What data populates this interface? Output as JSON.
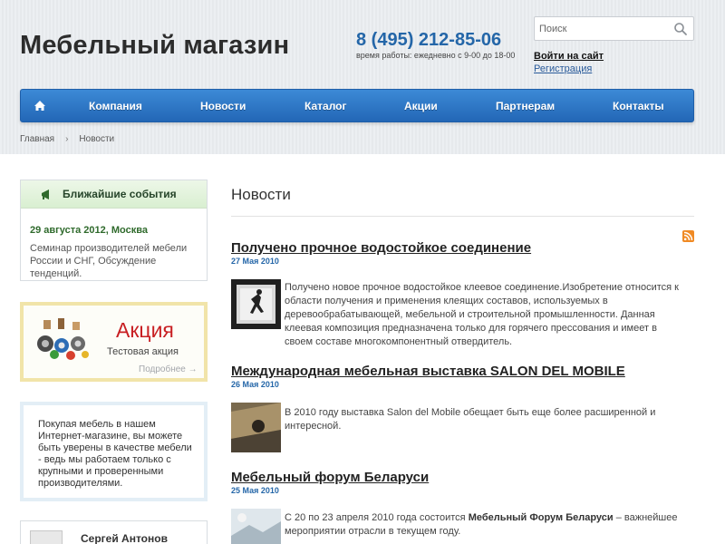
{
  "header": {
    "site_title": "Мебельный магазин",
    "phone": "8 (495) 212-85-06",
    "hours": "время работы: ежедневно с 9-00 до 18-00",
    "search_placeholder": "Поиск",
    "login": "Войти на сайт",
    "register": "Регистрация"
  },
  "nav": {
    "home_icon": "home-icon",
    "items": [
      "Компания",
      "Новости",
      "Каталог",
      "Акции",
      "Партнерам",
      "Контакты"
    ]
  },
  "breadcrumb": {
    "home": "Главная",
    "separator": "›",
    "current": "Новости"
  },
  "sidebar": {
    "events": {
      "title": "Ближайшие события",
      "date": "29 августа 2012, Москва",
      "text": "Семинар производителей мебели России и СНГ, Обсуждение тенденций."
    },
    "promo": {
      "title": "Акция",
      "subtitle": "Тестовая акция",
      "more": "Подробнее →"
    },
    "info": {
      "text": "Покупая мебель в нашем Интернет-магазине, вы можете быть уверены в качестве мебели - ведь мы работаем только с крупными и проверенными производителями."
    },
    "user": {
      "name": "Сергей Антонов"
    }
  },
  "main": {
    "heading": "Новости",
    "news": [
      {
        "title": "Получено прочное водостойкое соединение",
        "date": "27 Мая 2010",
        "text": "Получено новое прочное водостойкое клеевое соединение.Изобретение относится к области получения и применения клеящих составов, используемых в деревообрабатывающей, мебельной и строительной промышленности. Данная клеевая композиция предназначена только для горячего прессования и имеет в своем составе многокомпонентный отвердитель."
      },
      {
        "title": "Международная мебельная выставка SALON DEL MOBILE",
        "date": "26 Мая 2010",
        "text": "В 2010 году выставка Salon del Mobile обещает быть еще более расширенной и интересной."
      },
      {
        "title": "Мебельный форум Беларуси",
        "date": "25 Мая 2010",
        "text_before": "С 20 по 23 апреля 2010 года состоится ",
        "text_bold": "Мебельный Форум Беларуси",
        "text_after": " – важнейшее мероприятии отрасли в текущем году."
      }
    ]
  },
  "colors": {
    "accent_blue": "#2466a8",
    "nav_blue": "#2f78c8",
    "promo_red": "#c81f23",
    "events_green": "#2f6a2c"
  }
}
